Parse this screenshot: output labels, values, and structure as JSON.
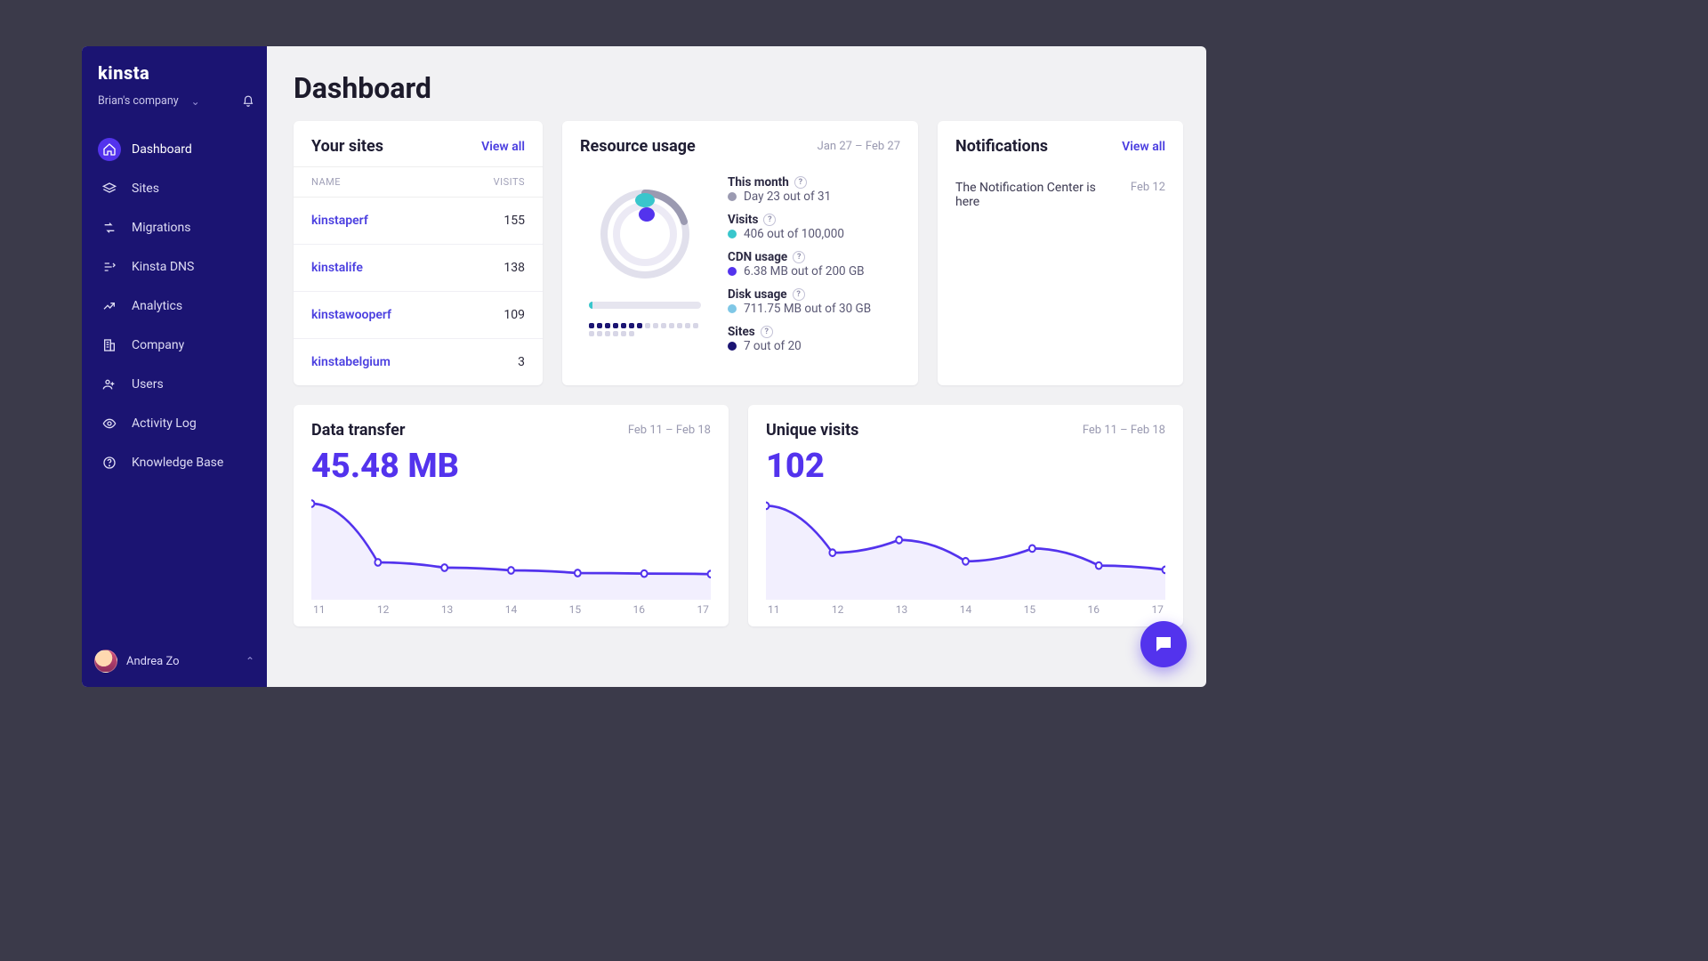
{
  "brand": "kinsta",
  "company": {
    "name": "Brian's company"
  },
  "user": {
    "name": "Andrea Zo"
  },
  "nav": [
    {
      "key": "dashboard",
      "label": "Dashboard",
      "icon": "home",
      "active": true
    },
    {
      "key": "sites",
      "label": "Sites",
      "icon": "layers"
    },
    {
      "key": "migrations",
      "label": "Migrations",
      "icon": "migrate"
    },
    {
      "key": "dns",
      "label": "Kinsta DNS",
      "icon": "dns"
    },
    {
      "key": "analytics",
      "label": "Analytics",
      "icon": "trend"
    },
    {
      "key": "company",
      "label": "Company",
      "icon": "building"
    },
    {
      "key": "users",
      "label": "Users",
      "icon": "users"
    },
    {
      "key": "activity",
      "label": "Activity Log",
      "icon": "eye"
    },
    {
      "key": "kb",
      "label": "Knowledge Base",
      "icon": "help"
    }
  ],
  "page_title": "Dashboard",
  "your_sites": {
    "title": "Your sites",
    "view_all": "View all",
    "columns": {
      "name": "NAME",
      "visits": "VISITS"
    },
    "rows": [
      {
        "name": "kinstaperf",
        "visits": "155"
      },
      {
        "name": "kinstalife",
        "visits": "138"
      },
      {
        "name": "kinstawooperf",
        "visits": "109"
      },
      {
        "name": "kinstabelgium",
        "visits": "3"
      }
    ]
  },
  "resource_usage": {
    "title": "Resource usage",
    "range": "Jan 27 – Feb 27",
    "items": [
      {
        "label": "This month",
        "value": "Day 23 out of 31",
        "color": "#9b9ab1"
      },
      {
        "label": "Visits",
        "value": "406 out of 100,000",
        "color": "#39c6cc"
      },
      {
        "label": "CDN usage",
        "value": "6.38 MB out of 200 GB",
        "color": "#5333ed"
      },
      {
        "label": "Disk usage",
        "value": "711.75 MB out of 30 GB",
        "color": "#7fc7e6"
      },
      {
        "label": "Sites",
        "value": "7 out of 20",
        "color": "#1b1472"
      }
    ],
    "sites_dots": {
      "on": 7,
      "total": 20
    }
  },
  "notifications": {
    "title": "Notifications",
    "view_all": "View all",
    "items": [
      {
        "text": "The Notification Center is here",
        "date": "Feb 12"
      }
    ]
  },
  "chart_data": [
    {
      "type": "line",
      "title": "Data transfer",
      "range": "Feb 11 – Feb 18",
      "headline": "45.48 MB",
      "x": [
        11,
        12,
        13,
        14,
        15,
        16,
        17
      ],
      "values": [
        18,
        7,
        6,
        5.5,
        5,
        4.9,
        4.8
      ],
      "ylim": [
        0,
        20
      ],
      "xlabel": "",
      "ylabel": ""
    },
    {
      "type": "line",
      "title": "Unique visits",
      "range": "Feb 11 – Feb 18",
      "headline": "102",
      "x": [
        11,
        12,
        13,
        14,
        15,
        16,
        17
      ],
      "values": [
        22,
        11,
        14,
        9,
        12,
        8,
        7
      ],
      "ylim": [
        0,
        25
      ],
      "xlabel": "",
      "ylabel": ""
    }
  ],
  "colors": {
    "accent": "#5333ed",
    "sidebar": "#1b1472",
    "teal": "#39c6cc"
  }
}
